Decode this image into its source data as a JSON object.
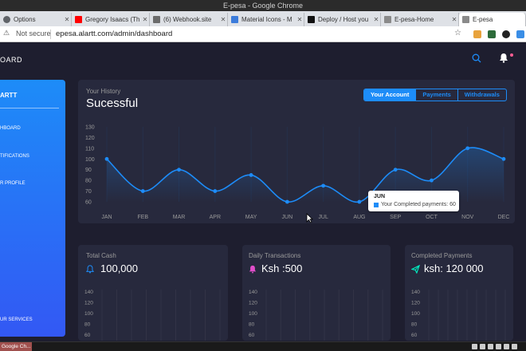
{
  "window": {
    "title": "E-pesa - Google Chrome"
  },
  "tabs": [
    {
      "label": "Options",
      "color": "#5f6368"
    },
    {
      "label": "Gregory Isaacs (Th",
      "color": "#ff0000"
    },
    {
      "label": "(6) Webhook.site",
      "color": "#6b6b6b"
    },
    {
      "label": "Material Icons - M",
      "color": "#3c7cdb"
    },
    {
      "label": "Deploy / Host you",
      "color": "#111111"
    },
    {
      "label": "E-pesa-Home",
      "color": "#8a8a8a"
    },
    {
      "label": "E-pesa",
      "color": "#8a8a8a"
    }
  ],
  "address": {
    "security": "Not secure",
    "url": "epesa.alartt.com/admin/dashboard"
  },
  "header": {
    "brand": "OARD"
  },
  "sidebar": {
    "title": "ARTT",
    "items": [
      "HBOARD",
      "TIFICATIONS",
      "R PROFILE",
      "UR SERVICES"
    ]
  },
  "main_card": {
    "category": "Your History",
    "title": "Sucessful",
    "buttons": [
      "Your Account",
      "Payments",
      "Withdrawals"
    ],
    "active_button": "Your Account",
    "tooltip": {
      "title": "JUN",
      "body": "Your Completed payments: 60"
    }
  },
  "cards": [
    {
      "category": "Total Cash",
      "value": "100,000",
      "icon": "bell-icon",
      "icon_color": "#1d8cf8"
    },
    {
      "category": "Daily Transactions",
      "value": "Ksh :500",
      "icon": "bell-icon",
      "icon_color": "#e14eca"
    },
    {
      "category": "Completed Payments",
      "value": "ksh: 120 000",
      "icon": "send-icon",
      "icon_color": "#00f2c3"
    }
  ],
  "small_chart_ticks": [
    "140",
    "120",
    "100",
    "80",
    "60"
  ],
  "taskbar": {
    "item": "Google Ch..."
  },
  "colors": {
    "accent": "#1d8cf8",
    "card": "#27293d",
    "background": "#1e1e2f"
  },
  "chart_data": {
    "type": "line",
    "categories": [
      "JAN",
      "FEB",
      "MAR",
      "APR",
      "MAY",
      "JUN",
      "JUL",
      "AUG",
      "SEP",
      "OCT",
      "NOV",
      "DEC"
    ],
    "values": [
      100,
      70,
      90,
      70,
      85,
      60,
      75,
      60,
      90,
      80,
      110,
      100
    ],
    "yticks": [
      130,
      120,
      110,
      100,
      90,
      80,
      70,
      60
    ],
    "ylim": [
      60,
      130
    ],
    "grid": true
  }
}
